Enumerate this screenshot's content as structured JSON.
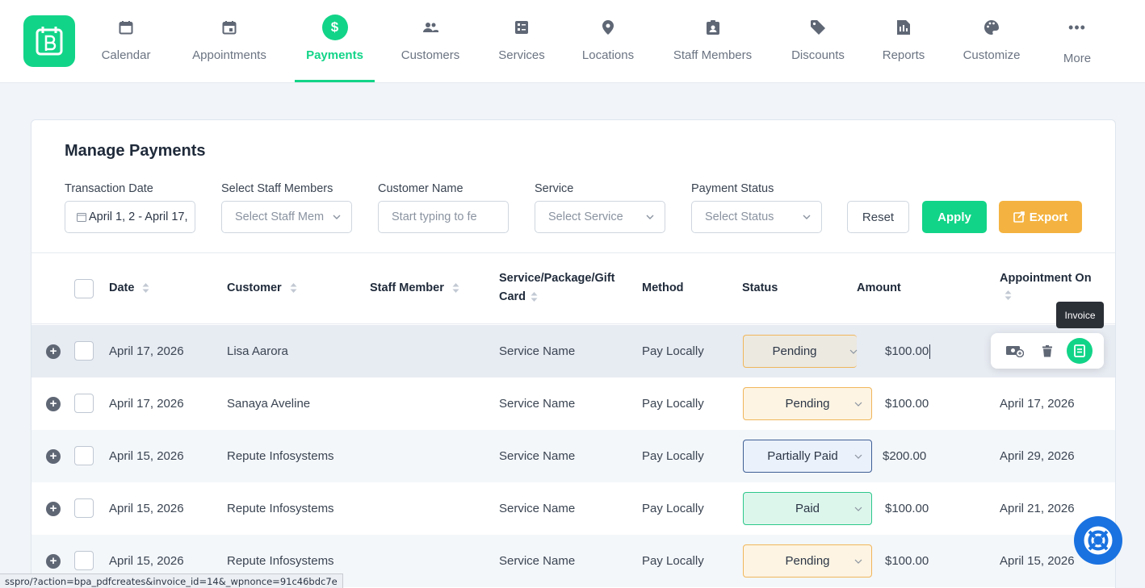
{
  "nav": {
    "items": [
      {
        "label": "Calendar",
        "icon": "calendar-icon"
      },
      {
        "label": "Appointments",
        "icon": "calendar-check-icon"
      },
      {
        "label": "Payments",
        "icon": "dollar-icon",
        "active": true
      },
      {
        "label": "Customers",
        "icon": "users-icon"
      },
      {
        "label": "Services",
        "icon": "services-icon"
      },
      {
        "label": "Locations",
        "icon": "location-pin-icon"
      },
      {
        "label": "Staff Members",
        "icon": "id-badge-icon"
      },
      {
        "label": "Discounts",
        "icon": "tag-icon"
      },
      {
        "label": "Reports",
        "icon": "report-icon"
      },
      {
        "label": "Customize",
        "icon": "palette-icon"
      },
      {
        "label": "More",
        "icon": "more-dots-icon"
      }
    ],
    "accent": "#12d488"
  },
  "page": {
    "title": "Manage Payments"
  },
  "filters": {
    "transaction_date": {
      "label": "Transaction Date",
      "value": "April 1, 2 - April 17,"
    },
    "staff": {
      "label": "Select Staff Members",
      "placeholder": "Select Staff Mem"
    },
    "customer": {
      "label": "Customer Name",
      "placeholder": "Start typing to fe"
    },
    "service": {
      "label": "Service",
      "placeholder": "Select Service"
    },
    "status": {
      "label": "Payment Status",
      "placeholder": "Select Status"
    },
    "reset_label": "Reset",
    "apply_label": "Apply",
    "export_label": "Export"
  },
  "table": {
    "columns": {
      "date": "Date",
      "customer": "Customer",
      "staff": "Staff Member",
      "service_1": "Service/Package/Gift",
      "service_2": "Card",
      "method": "Method",
      "status": "Status",
      "amount": "Amount",
      "appointment": "Appointment On"
    },
    "rows": [
      {
        "date": "April 17, 2026",
        "customer": "Lisa Aarora",
        "staff": "",
        "service": "Service Name",
        "method": "Pay Locally",
        "status": "Pending",
        "amount": "$100.00",
        "appointment": ""
      },
      {
        "date": "April 17, 2026",
        "customer": "Sanaya Aveline",
        "staff": "",
        "service": "Service Name",
        "method": "Pay Locally",
        "status": "Pending",
        "amount": "$100.00",
        "appointment": "April 17, 2026"
      },
      {
        "date": "April 15, 2026",
        "customer": "Repute Infosystems",
        "staff": "",
        "service": "Service Name",
        "method": "Pay Locally",
        "status": "Partially Paid",
        "amount": "$200.00",
        "appointment": "April 29, 2026"
      },
      {
        "date": "April 15, 2026",
        "customer": "Repute Infosystems",
        "staff": "",
        "service": "Service Name",
        "method": "Pay Locally",
        "status": "Paid",
        "amount": "$100.00",
        "appointment": "April 21, 2026"
      },
      {
        "date": "April 15, 2026",
        "customer": "Repute Infosystems",
        "staff": "",
        "service": "Service Name",
        "method": "Pay Locally",
        "status": "Pending",
        "amount": "$100.00",
        "appointment": "April 15, 2026"
      }
    ]
  },
  "row_actions": {
    "tooltip": "Invoice"
  },
  "statusbar": {
    "url": "sspro/?action=bpa_pdfcreates&invoice_id=14&_wpnonce=91c46bdc7e"
  }
}
